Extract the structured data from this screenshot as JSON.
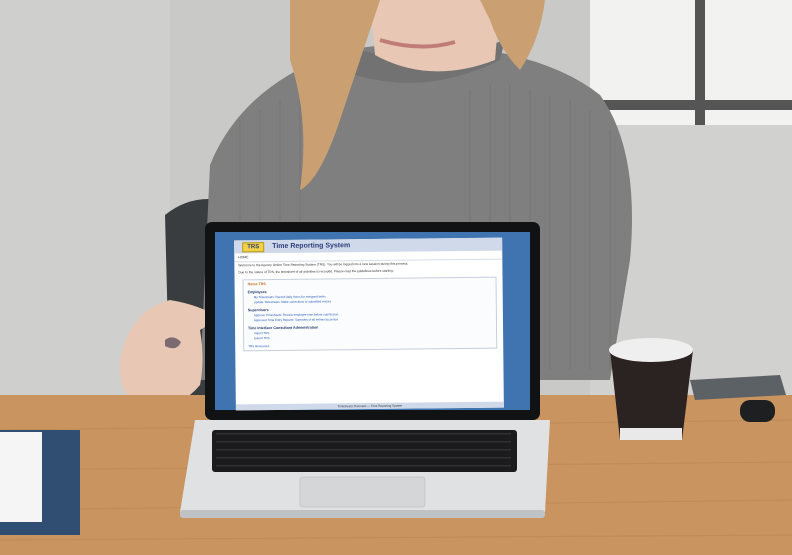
{
  "scene": {
    "colors": {
      "wall": "#c9c9c7",
      "window": "#f0f0ee",
      "sweater": "#7f7f80",
      "hair": "#caa072",
      "skin": "#e9c7b5",
      "desk": "#c99460",
      "laptop_silver": "#dfe1e3",
      "keyboard": "#1b1b1d",
      "cup": "#2b2321"
    }
  },
  "laptop_screen": {
    "logo": "TRS",
    "app_title": "Time Reporting System",
    "breadcrumb": "HOME",
    "intro_lines": [
      "Welcome to the Agency Online Time Reporting System (TRS). You will be logged into a new session during this process.",
      "Due to the nature of TRS, the timesheet of all activities is recorded. Please read the guidelines before starting."
    ],
    "panel_tab": "Home TRS",
    "sections": [
      {
        "title": "Employees",
        "links": [
          "My Timesheets: Record daily hours for assigned tasks",
          "Update Timesheets: Make corrections to submitted entries"
        ]
      },
      {
        "title": "Supervisors",
        "links": [
          "Approve Timesheets: Review employee time before submission",
          "Approved Time Entry Reports: Summary of all entries by period"
        ]
      },
      {
        "title": "Time Interface Consultant Administration",
        "links": [
          "Import TRS",
          "Export TRS"
        ]
      }
    ],
    "footer_link": "TRS Resources",
    "status_bar": "Timesheets Overview — Time Reporting System"
  }
}
